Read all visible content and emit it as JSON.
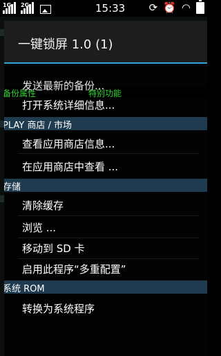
{
  "status_bar": {
    "time": "15:33",
    "signal1_tag": "1G",
    "signal2_tag": "2G",
    "icons": [
      "signal-icon",
      "signal-icon",
      "image-icon",
      "rotate-icon",
      "alarm-icon",
      "wifi-icon",
      "battery-icon"
    ]
  },
  "dialog": {
    "title": "一键锁屏 1.0 (1)",
    "accent_color": "#2fa7d6",
    "tabs": [
      "备份属性",
      "特别功能"
    ],
    "partial_item": "发送最新的备份...",
    "items_top": [
      "打开系统详细信息..."
    ],
    "sections": [
      {
        "header": "PLAY 商店 / 市场",
        "items": [
          "查看应用商店信息...",
          "在应用商店中查看 ..."
        ]
      },
      {
        "header": "存储",
        "items": [
          "清除缓存",
          "浏览 ...",
          "移动到 SD 卡",
          "启用此程序“多重配置”"
        ]
      },
      {
        "header": "系统 ROM",
        "items": [
          "转换为系统程序"
        ]
      }
    ]
  }
}
